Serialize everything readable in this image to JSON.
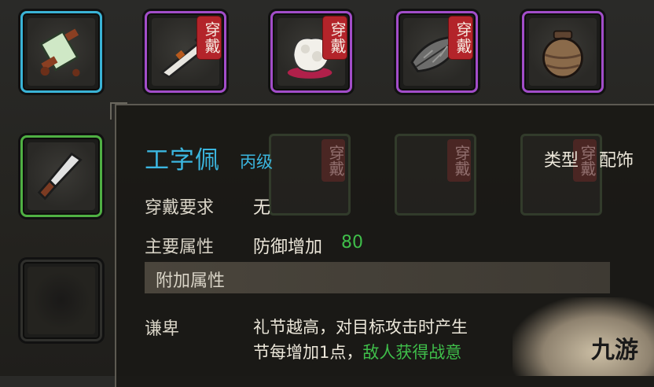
{
  "top_slots": [
    {
      "name": "scroll-item-slot",
      "border": "cyan",
      "badge": ""
    },
    {
      "name": "blade-item-slot",
      "border": "purple",
      "badge": "穿戴"
    },
    {
      "name": "cloth-item-slot",
      "border": "purple",
      "badge": "穿戴"
    },
    {
      "name": "leaf-item-slot",
      "border": "purple",
      "badge": "穿戴"
    },
    {
      "name": "jar-item-slot",
      "border": "purple",
      "badge": ""
    }
  ],
  "ghost_badge": "穿戴",
  "tooltip": {
    "item_name": "工字佩",
    "grade": "丙级",
    "type_label": "类型",
    "type_value": "配饰",
    "requirement_label": "穿戴要求",
    "requirement_value": "无",
    "main_attr_label": "主要属性",
    "main_attr_text": "防御增加",
    "main_attr_value": "80",
    "extra_section_label": "附加属性",
    "skill_name": "谦卑",
    "skill_desc_line1": "礼节越高，对目标攻击时产生",
    "skill_desc_line2_a": "节每增加1点，",
    "skill_desc_line2_b": "敌人获得战意"
  },
  "watermark": "九游",
  "colors": {
    "cyan": "#3ab3d6",
    "purple": "#a24dc9",
    "green": "#4fb043",
    "badge_red": "#b3242a",
    "title_blue": "#3bb6df",
    "value_green": "#3fbe4a"
  }
}
